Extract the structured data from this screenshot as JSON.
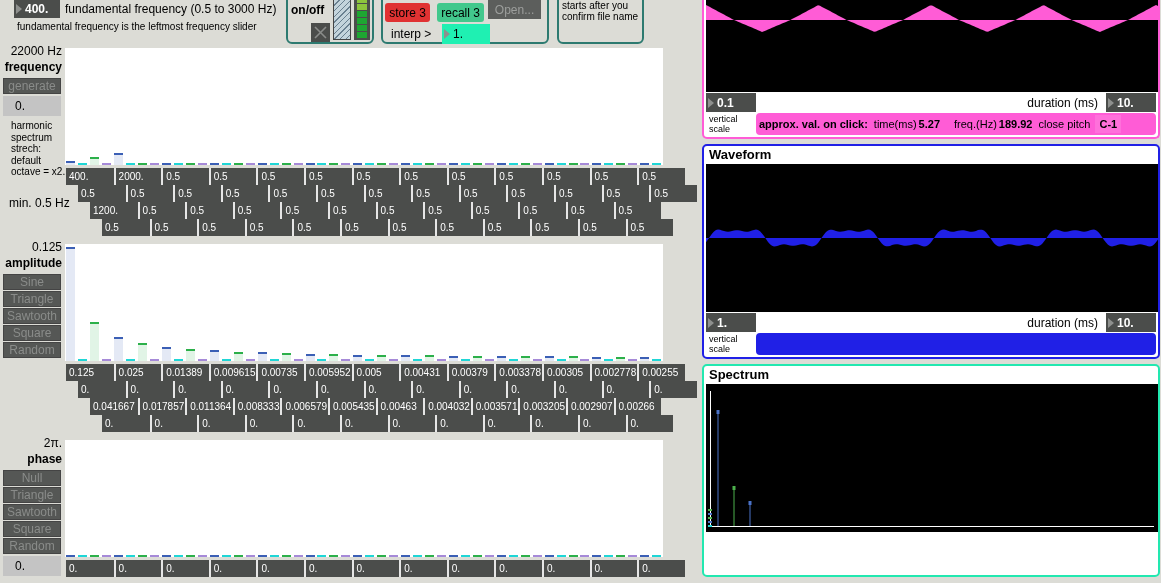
{
  "header": {
    "fundamental": {
      "value": "400.",
      "label": "fundamental frequency (0.5 to 3000 Hz)",
      "note": "fundamental frequency is the leftmost frequency slider"
    },
    "audio": {
      "label": "on/off"
    },
    "presets": {
      "store": "store 3",
      "recall": "recall 3",
      "open": "Open...",
      "interp_label": "interp >",
      "interp_value": "1."
    },
    "file_note": "starts after you confirm file name"
  },
  "sections": [
    {
      "max_label": "22000 Hz",
      "title": "frequency",
      "buttons": [
        "generate"
      ],
      "field": "0.",
      "note": "harmonic spectrum strech: default octave = x2.",
      "min_label": "min. 0.5 Hz",
      "rows": [
        {
          "color": "#3b5fb5",
          "boxes": [
            {
              "value": "400.",
              "level": 0.018
            },
            {
              "value": "2000.",
              "level": 0.091
            },
            {
              "value": "0.5",
              "level": 0
            },
            {
              "value": "0.5",
              "level": 0
            },
            {
              "value": "0.5",
              "level": 0
            },
            {
              "value": "0.5",
              "level": 0
            },
            {
              "value": "0.5",
              "level": 0
            },
            {
              "value": "0.5",
              "level": 0
            },
            {
              "value": "0.5",
              "level": 0
            },
            {
              "value": "0.5",
              "level": 0
            },
            {
              "value": "0.5",
              "level": 0
            },
            {
              "value": "0.5",
              "level": 0
            },
            {
              "value": "0.5",
              "level": 0
            }
          ]
        },
        {
          "color": "#1fd6d6",
          "boxes": [
            {
              "value": "0.5",
              "level": 0
            },
            {
              "value": "0.5",
              "level": 0
            },
            {
              "value": "0.5",
              "level": 0
            },
            {
              "value": "0.5",
              "level": 0
            },
            {
              "value": "0.5",
              "level": 0
            },
            {
              "value": "0.5",
              "level": 0
            },
            {
              "value": "0.5",
              "level": 0
            },
            {
              "value": "0.5",
              "level": 0
            },
            {
              "value": "0.5",
              "level": 0
            },
            {
              "value": "0.5",
              "level": 0
            },
            {
              "value": "0.5",
              "level": 0
            },
            {
              "value": "0.5",
              "level": 0
            },
            {
              "value": "0.5",
              "level": 0
            }
          ]
        },
        {
          "color": "#2cb04a",
          "boxes": [
            {
              "value": "1200.",
              "level": 0.055
            },
            {
              "value": "0.5",
              "level": 0
            },
            {
              "value": "0.5",
              "level": 0
            },
            {
              "value": "0.5",
              "level": 0
            },
            {
              "value": "0.5",
              "level": 0
            },
            {
              "value": "0.5",
              "level": 0
            },
            {
              "value": "0.5",
              "level": 0
            },
            {
              "value": "0.5",
              "level": 0
            },
            {
              "value": "0.5",
              "level": 0
            },
            {
              "value": "0.5",
              "level": 0
            },
            {
              "value": "0.5",
              "level": 0
            },
            {
              "value": "0.5",
              "level": 0
            }
          ]
        },
        {
          "color": "#a68ad8",
          "boxes": [
            {
              "value": "0.5",
              "level": 0
            },
            {
              "value": "0.5",
              "level": 0
            },
            {
              "value": "0.5",
              "level": 0
            },
            {
              "value": "0.5",
              "level": 0
            },
            {
              "value": "0.5",
              "level": 0
            },
            {
              "value": "0.5",
              "level": 0
            },
            {
              "value": "0.5",
              "level": 0
            },
            {
              "value": "0.5",
              "level": 0
            },
            {
              "value": "0.5",
              "level": 0
            },
            {
              "value": "0.5",
              "level": 0
            },
            {
              "value": "0.5",
              "level": 0
            },
            {
              "value": "0.5",
              "level": 0
            }
          ]
        }
      ]
    },
    {
      "max_label": "0.125",
      "title": "amplitude",
      "buttons": [
        "Sine",
        "Triangle",
        "Sawtooth",
        "Square",
        "Random"
      ],
      "rows": [
        {
          "color": "#3b5fb5",
          "boxes": [
            {
              "value": "0.125",
              "level": 1
            },
            {
              "value": "0.025",
              "level": 0.2
            },
            {
              "value": "0.01389",
              "level": 0.111
            },
            {
              "value": "0.009615",
              "level": 0.077
            },
            {
              "value": "0.00735",
              "level": 0.059
            },
            {
              "value": "0.005952",
              "level": 0.048
            },
            {
              "value": "0.005",
              "level": 0.04
            },
            {
              "value": "0.00431",
              "level": 0.034
            },
            {
              "value": "0.00379",
              "level": 0.03
            },
            {
              "value": "0.003378",
              "level": 0.027
            },
            {
              "value": "0.00305",
              "level": 0.024
            },
            {
              "value": "0.002778",
              "level": 0.022
            },
            {
              "value": "0.00255",
              "level": 0.02
            }
          ]
        },
        {
          "color": "#1fd6d6",
          "boxes": [
            {
              "value": "0.",
              "level": 0
            },
            {
              "value": "0.",
              "level": 0
            },
            {
              "value": "0.",
              "level": 0
            },
            {
              "value": "0.",
              "level": 0
            },
            {
              "value": "0.",
              "level": 0
            },
            {
              "value": "0.",
              "level": 0
            },
            {
              "value": "0.",
              "level": 0
            },
            {
              "value": "0.",
              "level": 0
            },
            {
              "value": "0.",
              "level": 0
            },
            {
              "value": "0.",
              "level": 0
            },
            {
              "value": "0.",
              "level": 0
            },
            {
              "value": "0.",
              "level": 0
            },
            {
              "value": "0.",
              "level": 0
            }
          ]
        },
        {
          "color": "#2cb04a",
          "boxes": [
            {
              "value": "0.041667",
              "level": 0.333
            },
            {
              "value": "0.017857",
              "level": 0.143
            },
            {
              "value": "0.011364",
              "level": 0.091
            },
            {
              "value": "0.008333",
              "level": 0.067
            },
            {
              "value": "0.006579",
              "level": 0.053
            },
            {
              "value": "0.005435",
              "level": 0.043
            },
            {
              "value": "0.00463",
              "level": 0.037
            },
            {
              "value": "0.004032",
              "level": 0.032
            },
            {
              "value": "0.003571",
              "level": 0.029
            },
            {
              "value": "0.003205",
              "level": 0.026
            },
            {
              "value": "0.002907",
              "level": 0.023
            },
            {
              "value": "0.00266",
              "level": 0.021
            }
          ]
        },
        {
          "color": "#a68ad8",
          "boxes": [
            {
              "value": "0.",
              "level": 0
            },
            {
              "value": "0.",
              "level": 0
            },
            {
              "value": "0.",
              "level": 0
            },
            {
              "value": "0.",
              "level": 0
            },
            {
              "value": "0.",
              "level": 0
            },
            {
              "value": "0.",
              "level": 0
            },
            {
              "value": "0.",
              "level": 0
            },
            {
              "value": "0.",
              "level": 0
            },
            {
              "value": "0.",
              "level": 0
            },
            {
              "value": "0.",
              "level": 0
            },
            {
              "value": "0.",
              "level": 0
            },
            {
              "value": "0.",
              "level": 0
            }
          ]
        }
      ]
    },
    {
      "max_label": "2π.",
      "title": "phase",
      "buttons": [
        "Null",
        "Triangle",
        "Sawtooth",
        "Square",
        "Random"
      ],
      "field": "0.",
      "rows": [
        {
          "color": "#3b5fb5",
          "boxes": [
            {
              "value": "0.",
              "level": 0
            },
            {
              "value": "0.",
              "level": 0
            },
            {
              "value": "0.",
              "level": 0
            },
            {
              "value": "0.",
              "level": 0
            },
            {
              "value": "0.",
              "level": 0
            },
            {
              "value": "0.",
              "level": 0
            },
            {
              "value": "0.",
              "level": 0
            },
            {
              "value": "0.",
              "level": 0
            },
            {
              "value": "0.",
              "level": 0
            },
            {
              "value": "0.",
              "level": 0
            },
            {
              "value": "0.",
              "level": 0
            },
            {
              "value": "0.",
              "level": 0
            },
            {
              "value": "0.",
              "level": 0
            }
          ]
        },
        {
          "color": "#1fd6d6",
          "boxes": [
            {
              "level": 0
            },
            {
              "level": 0
            },
            {
              "level": 0
            },
            {
              "level": 0
            },
            {
              "level": 0
            },
            {
              "level": 0
            },
            {
              "level": 0
            },
            {
              "level": 0
            },
            {
              "level": 0
            },
            {
              "level": 0
            },
            {
              "level": 0
            },
            {
              "level": 0
            },
            {
              "level": 0
            }
          ]
        },
        {
          "color": "#2cb04a",
          "boxes": [
            {
              "level": 0
            },
            {
              "level": 0
            },
            {
              "level": 0
            },
            {
              "level": 0
            },
            {
              "level": 0
            },
            {
              "level": 0
            },
            {
              "level": 0
            },
            {
              "level": 0
            },
            {
              "level": 0
            },
            {
              "level": 0
            },
            {
              "level": 0
            },
            {
              "level": 0
            }
          ]
        },
        {
          "color": "#a68ad8",
          "boxes": [
            {
              "level": 0
            },
            {
              "level": 0
            },
            {
              "level": 0
            },
            {
              "level": 0
            },
            {
              "level": 0
            },
            {
              "level": 0
            },
            {
              "level": 0
            },
            {
              "level": 0
            },
            {
              "level": 0
            },
            {
              "level": 0
            },
            {
              "level": 0
            },
            {
              "level": 0
            }
          ]
        }
      ]
    }
  ],
  "panels": [
    {
      "kind": "scope",
      "color": "#ff5cd6",
      "display": {
        "kind": "triangle"
      },
      "vertical_scale": "0.1",
      "vertical_label": "vertical scale",
      "duration_label": "duration (ms)",
      "duration": "10.",
      "readout": {
        "label": "approx. val. on click:",
        "time_label": "time(ms)",
        "time": "5.27",
        "freq_label": "freq.(Hz)",
        "freq": "189.92",
        "pitch_label": "close pitch",
        "pitch": "C-1"
      }
    },
    {
      "kind": "scope",
      "color": "#2020e6",
      "title": "Waveform",
      "display": {
        "kind": "stepped"
      },
      "vertical_scale": "1.",
      "vertical_label": "vertical scale",
      "duration_label": "duration (ms)",
      "duration": "10."
    },
    {
      "kind": "spectrum",
      "color": "#22e8b0",
      "title": "Spectrum"
    }
  ]
}
